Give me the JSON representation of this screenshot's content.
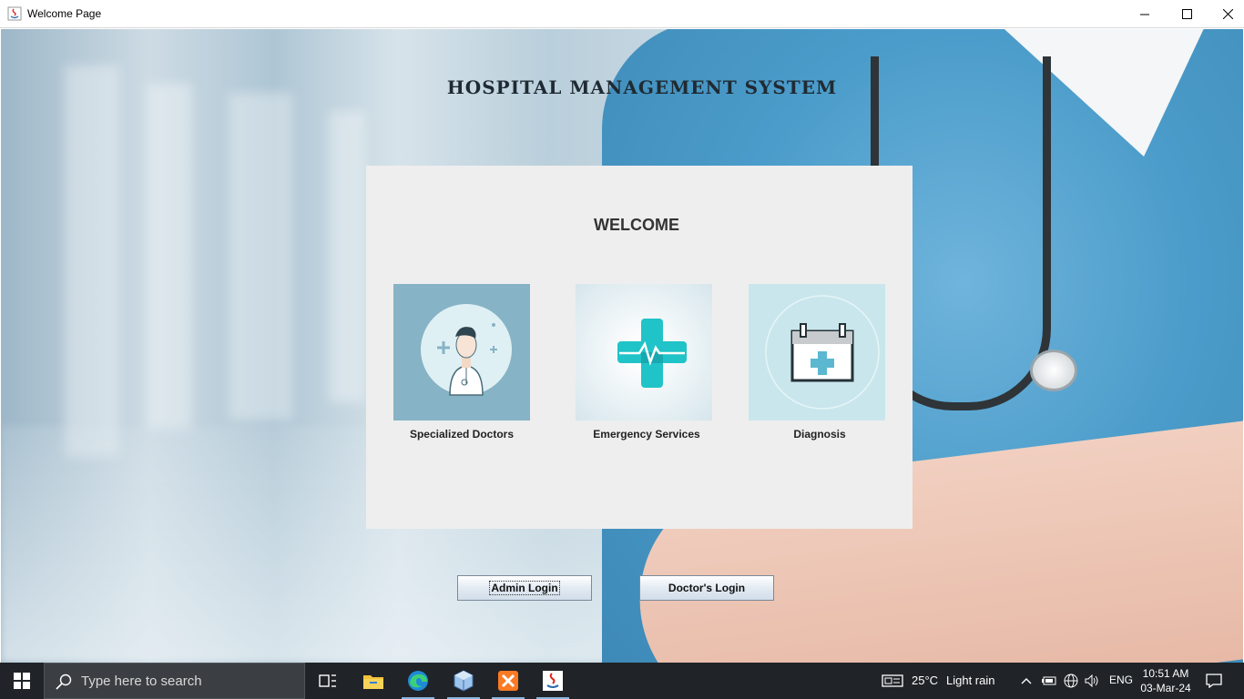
{
  "window": {
    "title": "Welcome Page",
    "minimize_icon": "minimize-icon",
    "maximize_icon": "maximize-icon",
    "close_icon": "close-icon"
  },
  "header": {
    "title": "HOSPITAL MANAGEMENT SYSTEM"
  },
  "panel": {
    "heading": "WELCOME",
    "cards": [
      {
        "label": "Specialized Doctors",
        "icon": "doctor-icon",
        "bg": "#86b3c5"
      },
      {
        "label": "Emergency Services",
        "icon": "medical-cross-icon",
        "bg": "#e6f0f3"
      },
      {
        "label": "Diagnosis",
        "icon": "calendar-medical-icon",
        "bg": "#c9e6ec"
      }
    ]
  },
  "buttons": {
    "admin_login": "Admin Login",
    "doctor_login": "Doctor's Login"
  },
  "taskbar": {
    "search_placeholder": "Type here to search",
    "weather_temp": "25°C",
    "weather_desc": "Light rain",
    "language": "ENG",
    "time": "10:51 AM",
    "date": "03-Mar-24",
    "apps": [
      "task-view-icon",
      "file-explorer-icon",
      "edge-icon",
      "virtualbox-icon",
      "xampp-icon",
      "java-icon"
    ]
  }
}
